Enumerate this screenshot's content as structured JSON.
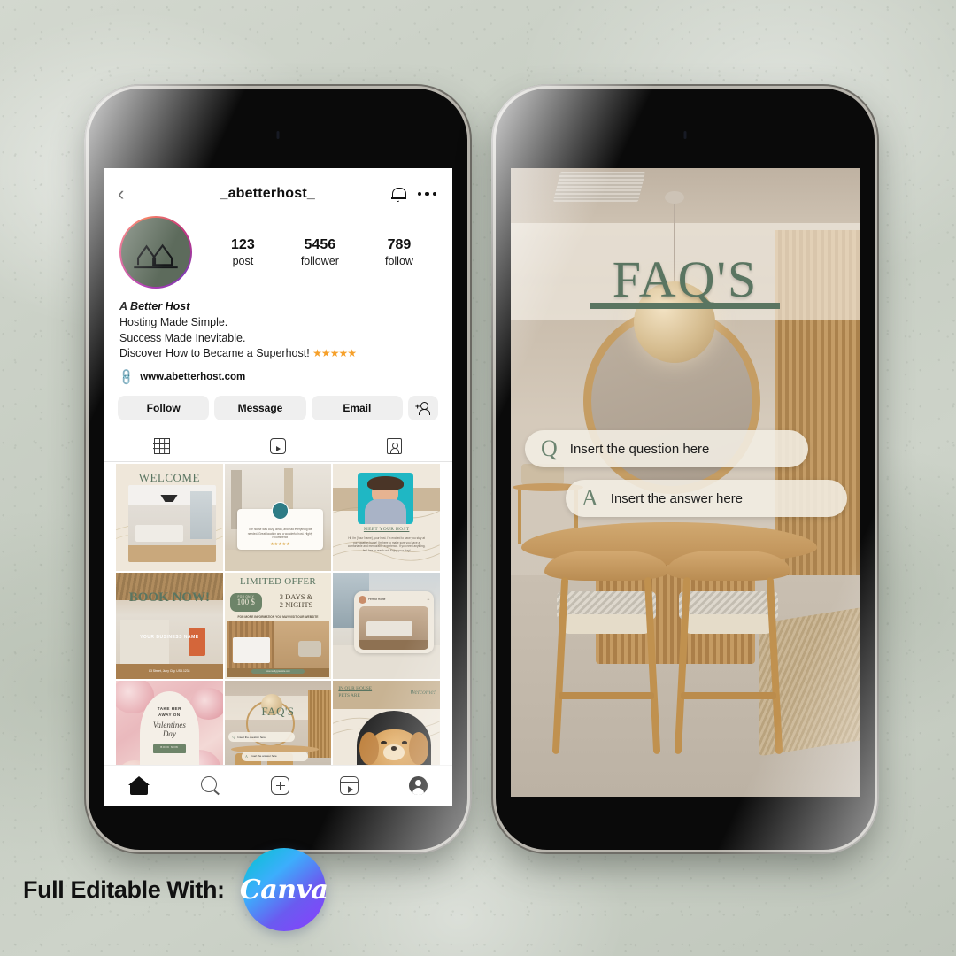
{
  "background": {
    "color": "#c9cfc5",
    "texture": "concrete"
  },
  "left_phone": {
    "app": "Instagram",
    "header": {
      "back_icon": "chevron-left-icon",
      "username": "_abetterhost_",
      "bell_icon": "bell-icon",
      "more_icon": "more-dots-icon"
    },
    "avatar": {
      "icon": "house-logo-icon",
      "bg_color": "#5d6b5c",
      "ring": "gradient-pink-purple"
    },
    "stats": [
      {
        "value": "123",
        "label": "post"
      },
      {
        "value": "5456",
        "label": "follower"
      },
      {
        "value": "789",
        "label": "follow"
      }
    ],
    "bio": {
      "name": "A Better Host",
      "line1": "Hosting Made Simple.",
      "line2": "Success Made Inevitable.",
      "line3": "Discover How to Became a Superhost!",
      "stars": "★★★★★",
      "star_color": "#f6a02a",
      "link_icon": "link-icon",
      "link": "www.abetterhost.com"
    },
    "actions": {
      "follow": "Follow",
      "message": "Message",
      "email": "Email",
      "add_user_icon": "add-user-icon"
    },
    "tabs": [
      {
        "icon": "grid-icon",
        "name": "grid"
      },
      {
        "icon": "reels-icon",
        "name": "reels"
      },
      {
        "icon": "tagged-icon",
        "name": "tagged"
      }
    ],
    "grid": [
      {
        "id": "welcome",
        "title": "WELCOME",
        "kind": "interior-photo"
      },
      {
        "id": "review",
        "title": "The house was cozy, clean, and had everything we needed. Great location and a wonderful host. Highly recommend!",
        "kind": "testimonial",
        "stars": "★★★★★"
      },
      {
        "id": "meet-host",
        "title": "MEET YOUR HOST",
        "kind": "portrait",
        "body": "Hi, I'm [Your Name], your host. I'm excited to have you stay at our vacation home! I'm here to make sure you have a comfortable and memorable experience. If you need anything, feel free to reach out. Enjoy your stay!"
      },
      {
        "id": "book-now",
        "title": "BOOK NOW!",
        "kind": "interior-photo",
        "sub": "YOUR BUSINESS NAME",
        "addr": "83 Street, Juby City, USA 1234"
      },
      {
        "id": "limited-offer",
        "title": "LIMITED OFFER",
        "kind": "promo",
        "price_label": "FOR ONLY",
        "price": "100 $",
        "offer_line1": "3 DAYS &",
        "offer_line2": "2 NIGHTS",
        "note": "FOR MORE INFORMATION YOU MAY VISIT OUR WEBSITE",
        "website": "www.reallygreatsite.com"
      },
      {
        "id": "bedroom-post",
        "title": "",
        "kind": "post-mockup",
        "handle": "Perfect Home"
      },
      {
        "id": "valentines",
        "title_l1": "TAKE HER",
        "title_l2": "AWAY ON",
        "script1": "Valentines",
        "script2": "Day",
        "cta": "BOOK NOW",
        "kind": "roses"
      },
      {
        "id": "faq",
        "title": "FAQ'S",
        "kind": "faq",
        "q": "Insert the question here",
        "a": "Insert the answer here"
      },
      {
        "id": "pets",
        "title_l1": "IN OUR HOUSE",
        "title_l2": "PETS ARE",
        "script": "Welcome!",
        "kind": "dog"
      }
    ],
    "bottom_nav": [
      {
        "icon": "home-icon",
        "name": "home",
        "active": true
      },
      {
        "icon": "search-icon",
        "name": "search",
        "active": false
      },
      {
        "icon": "plus-box-icon",
        "name": "create",
        "active": false
      },
      {
        "icon": "reels-icon",
        "name": "reels",
        "active": false
      },
      {
        "icon": "profile-icon",
        "name": "profile",
        "active": false
      }
    ]
  },
  "right_phone": {
    "template": "FAQ Story",
    "title": "FAQ'S",
    "title_color": "#5a7561",
    "question": {
      "letter": "Q",
      "text": "Insert the question here"
    },
    "answer": {
      "letter": "A",
      "text": "Insert the answer here"
    }
  },
  "footer": {
    "label": "Full Editable With:",
    "brand": "Canva",
    "brand_gradient_from": "#00c4cc",
    "brand_gradient_to": "#8b3dff"
  }
}
